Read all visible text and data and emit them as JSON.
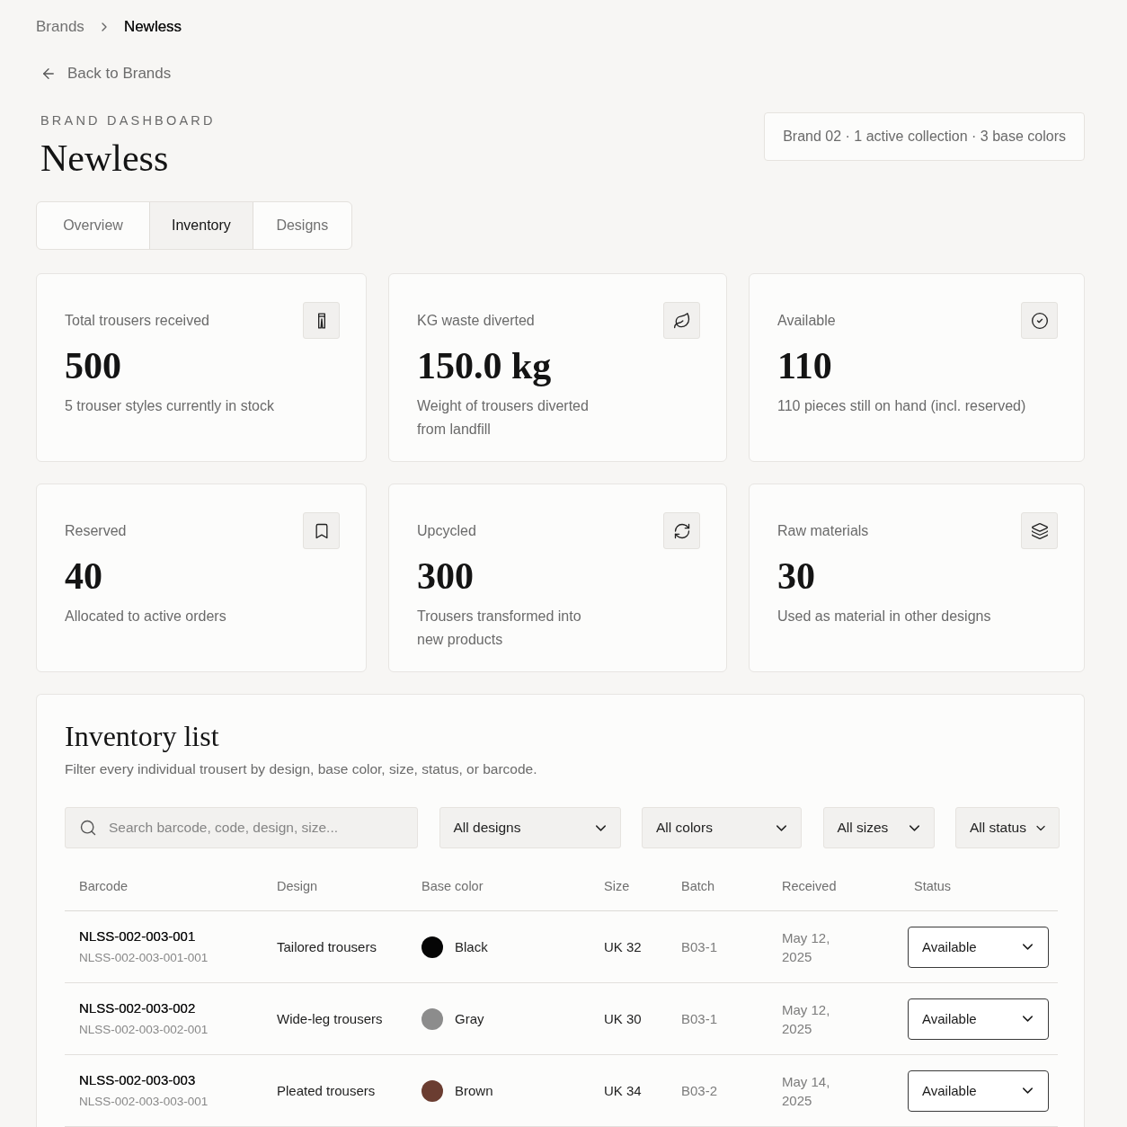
{
  "breadcrumb": [
    {
      "label": "Brands",
      "current": false
    },
    {
      "label": "Newless",
      "current": true
    }
  ],
  "back_link": "Back to Brands",
  "header": {
    "eyebrow": "BRAND DASHBOARD",
    "title": "Newless",
    "summary": "Brand 02 · 1 active collection · 3 base colors"
  },
  "tabs": [
    {
      "label": "Overview",
      "selected": false
    },
    {
      "label": "Inventory",
      "selected": true
    },
    {
      "label": "Designs",
      "selected": false
    }
  ],
  "stats": [
    {
      "label": "Total trousers received",
      "value": "500",
      "note": "5 trouser styles currently in stock"
    },
    {
      "label": "KG waste diverted",
      "value": "150.0 kg",
      "note": "Weight of trousers diverted\nfrom landfill"
    },
    {
      "label": "Available",
      "value": "110",
      "note": "110 pieces still on hand (incl. reserved)"
    },
    {
      "label": "Reserved",
      "value": "40",
      "note": "Allocated to active orders"
    },
    {
      "label": "Upcycled",
      "value": "300",
      "note": "Trousers transformed into\nnew products"
    },
    {
      "label": "Raw materials",
      "value": "30",
      "note": "Used as material in other designs"
    }
  ],
  "inventory": {
    "title": "Inventory list",
    "description": "Filter every individual trousert by design, base color, size, status, or barcode.",
    "search": {
      "placeholder": "Search barcode, code, design, size..."
    },
    "filters": [
      "All designs",
      "All colors",
      "All sizes",
      "All status"
    ],
    "columns": [
      "Barcode",
      "Design",
      "Base color",
      "Size",
      "Batch",
      "Received",
      "Status"
    ],
    "rows": [
      {
        "barcode": "NLSS-002-003-001",
        "code": "NLSS-002-003-001-001",
        "design": "Tailored trousers",
        "base_color": "Black",
        "color": "#050505",
        "size": "UK 32",
        "batch": "B03-1",
        "received": "May 12, 2025",
        "status": "Available"
      },
      {
        "barcode": "NLSS-002-003-002",
        "code": "NLSS-002-003-002-001",
        "design": "Wide-leg trousers",
        "base_color": "Gray",
        "color": "#8c8c8c",
        "size": "UK 30",
        "batch": "B03-1",
        "received": "May 12, 2025",
        "status": "Available"
      },
      {
        "barcode": "NLSS-002-003-003",
        "code": "NLSS-002-003-003-001",
        "design": "Pleated trousers",
        "base_color": "Brown",
        "color": "#6b3d31",
        "size": "UK 34",
        "batch": "B03-2",
        "received": "May 14, 2025",
        "status": "Available"
      }
    ]
  }
}
